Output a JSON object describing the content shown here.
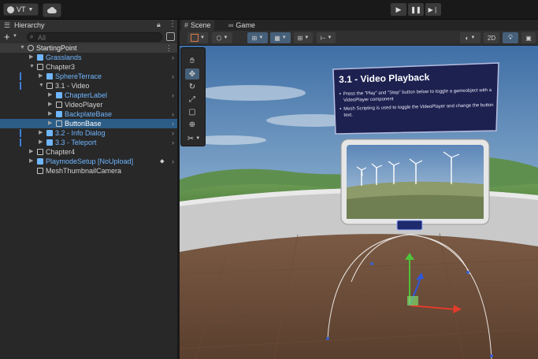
{
  "toolbar": {
    "account_label": "VT",
    "account_icon": "user-icon",
    "cloud_icon": "cloud-icon",
    "play_icon": "play-icon",
    "pause_icon": "pause-icon",
    "step_icon": "step-icon"
  },
  "hierarchy": {
    "title": "Hierarchy",
    "add_label": "+",
    "search_placeholder": "All",
    "items": [
      {
        "label": "StartingPoint",
        "depth": 0,
        "expanded": true,
        "root": true
      },
      {
        "label": "Grasslands",
        "depth": 1,
        "expanded": false,
        "prefab": true
      },
      {
        "label": "Chapter3",
        "depth": 1,
        "expanded": true
      },
      {
        "label": "SphereTerrace",
        "depth": 2,
        "expanded": false,
        "prefab": true,
        "modified": true
      },
      {
        "label": "3.1 - Video",
        "depth": 2,
        "expanded": true,
        "modified": true
      },
      {
        "label": "ChapterLabel",
        "depth": 3,
        "expanded": false,
        "prefab": true
      },
      {
        "label": "VideoPlayer",
        "depth": 3,
        "expanded": false
      },
      {
        "label": "BackplateBase",
        "depth": 3,
        "expanded": false,
        "prefab": true
      },
      {
        "label": "ButtonBase",
        "depth": 3,
        "expanded": false,
        "selected": true
      },
      {
        "label": "3.2 - Info Dialog",
        "depth": 2,
        "expanded": false,
        "prefab": true,
        "modified": true
      },
      {
        "label": "3.3 - Teleport",
        "depth": 2,
        "expanded": false,
        "prefab": true,
        "modified": true
      },
      {
        "label": "Chapter4",
        "depth": 1,
        "expanded": false
      },
      {
        "label": "PlaymodeSetup [NoUpload]",
        "depth": 1,
        "expanded": false,
        "prefab": true,
        "tag": true
      },
      {
        "label": "MeshThumbnailCamera",
        "depth": 1,
        "expanded": false
      }
    ]
  },
  "scene": {
    "tab_scene": "Scene",
    "tab_game": "Game",
    "mode_2d": "2D",
    "panel_title": "3.1 - Video Playback",
    "bullets": [
      "Press the \"Play\" and \"Stop\" button below to toggle a gameobject with a VideoPlayer component",
      "Mesh Scripting is used to toggle the VideoPlayer and change the button text."
    ]
  },
  "colors": {
    "accent": "#2c5d87",
    "prefab_blue": "#6fb6ff",
    "panel_bg": "#1c2150"
  }
}
